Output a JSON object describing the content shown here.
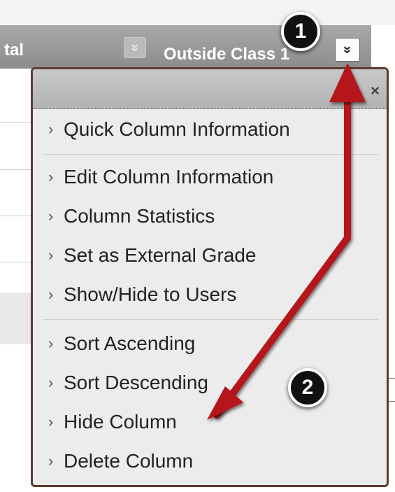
{
  "header": {
    "left_column_label": "tal",
    "main_column_label": "Outside Class 1",
    "faded_chevron": "»",
    "active_chevron": "»"
  },
  "menu": {
    "close_label": "×",
    "groups": [
      [
        "Quick Column Information"
      ],
      [
        "Edit Column Information",
        "Column Statistics",
        "Set as External Grade",
        "Show/Hide to Users"
      ],
      [
        "Sort Ascending",
        "Sort Descending",
        "Hide Column",
        "Delete Column"
      ]
    ],
    "caret": "›"
  },
  "callouts": {
    "one": "1",
    "two": "2"
  },
  "colors": {
    "arrow": "#b5121b",
    "menu_border": "#5c3d2e",
    "header_bg": "#9a9a9a"
  }
}
